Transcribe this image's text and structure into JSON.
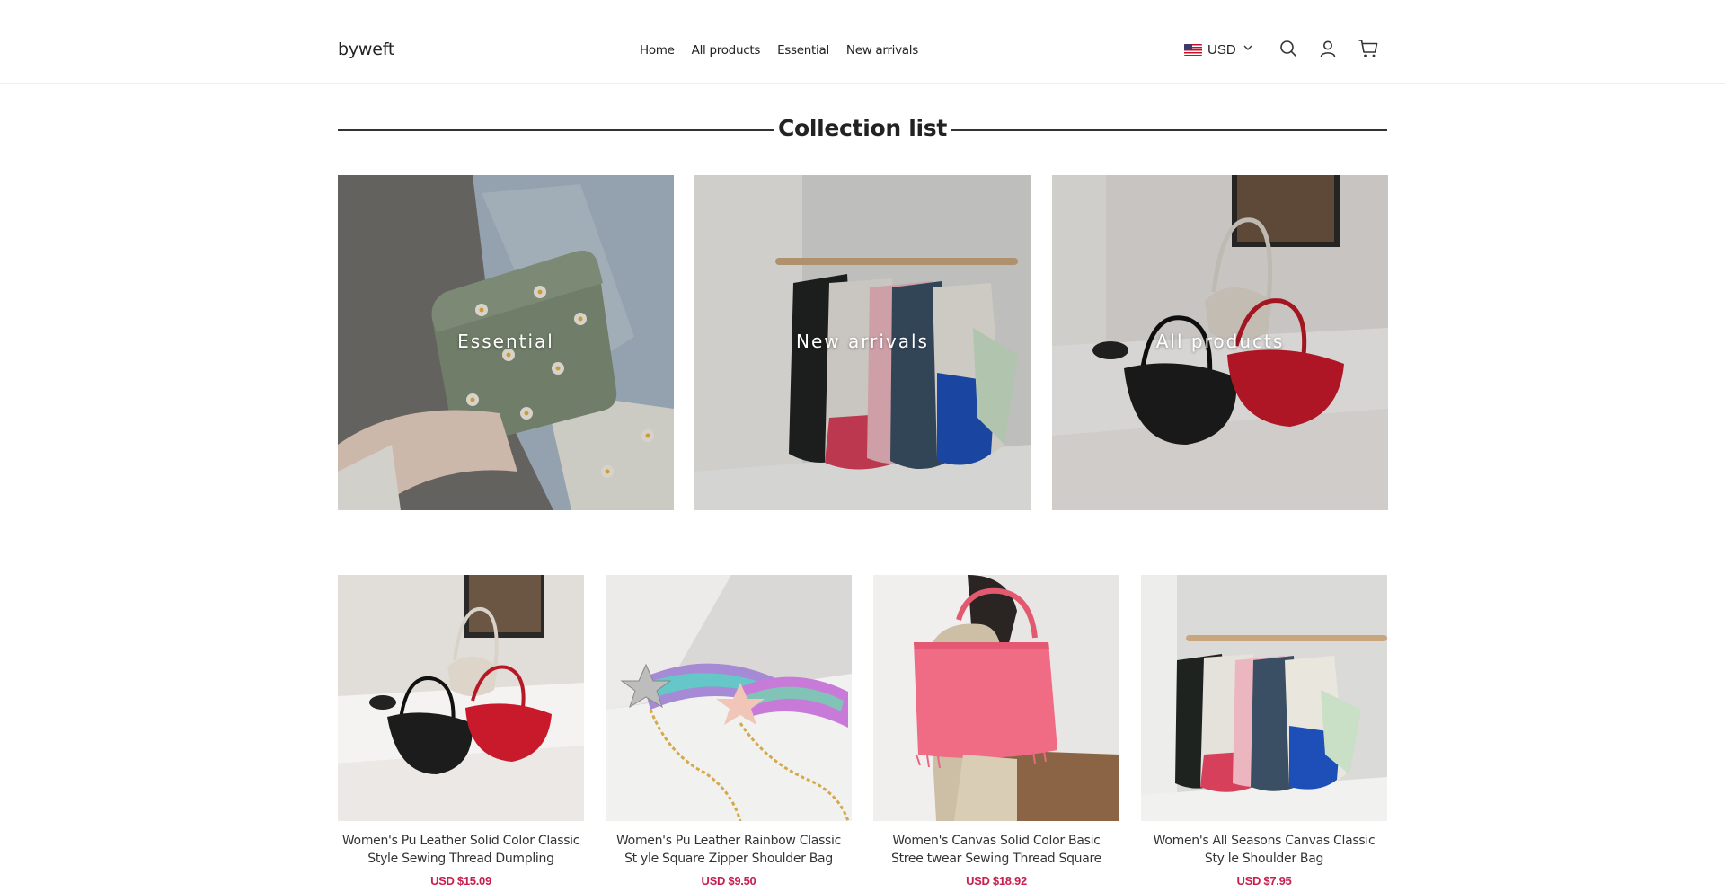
{
  "header": {
    "logo": "byweft",
    "nav": [
      "Home",
      "All products",
      "Essential",
      "New arrivals"
    ],
    "currency": "USD",
    "icons": [
      "search-icon",
      "account-icon",
      "cart-icon"
    ]
  },
  "collection_section": {
    "title": "Collection list",
    "tiles": [
      {
        "label": "Essential"
      },
      {
        "label": "New arrivals"
      },
      {
        "label": "All products"
      }
    ]
  },
  "products": [
    {
      "title": "Women's Pu Leather Solid Color Classic Style Sewing Thread Dumpling Shape…",
      "price": "USD $15.09"
    },
    {
      "title": "Women's Pu Leather Rainbow Classic St yle Square Zipper Shoulder Bag Cross…",
      "price": "USD $9.50"
    },
    {
      "title": "Women's Canvas Solid Color Basic Stree twear Sewing Thread Square Open Sh…",
      "price": "USD $18.92"
    },
    {
      "title": "Women's All Seasons Canvas Classic Sty le Shoulder Bag",
      "price": "USD $7.95"
    }
  ],
  "colors": {
    "price": "#c8204e",
    "text": "#222222",
    "divider": "#eeeeee"
  }
}
